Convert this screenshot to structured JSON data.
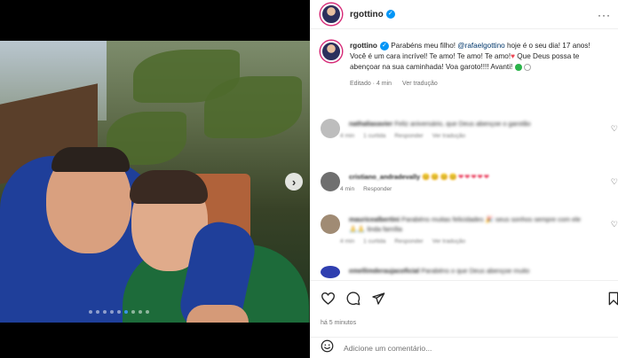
{
  "post": {
    "username": "rgottino",
    "verified_mark": "✓",
    "more_glyph": "···"
  },
  "caption": {
    "username": "rgottino",
    "text_1": " Parabéns meu filho! ",
    "mention": "@rafaelgottino",
    "text_2": " hoje é o seu dia! 17 anos! Você é um cara incrível! Te amo! Te amo! Te amo!",
    "heart": "♥",
    "text_3": " Que Deus possa te abençoar na sua caminhada! Voa garoto!!!! Avanti!",
    "edited": "Editado · 4 min",
    "translate": "Ver tradução"
  },
  "comments": [
    {
      "user": "nathaliaxavier",
      "text": "Feliz aniversário, que Deus abençoe o garotão",
      "meta_time": "4 min",
      "meta_likes": "1 curtida",
      "meta_reply": "Responder",
      "meta_translate": "Ver tradução"
    },
    {
      "user": "cristiano_andradevally",
      "text": "",
      "emoji": "😊😊😊😊",
      "emoji2": "❤❤❤❤❤",
      "meta_time": "4 min",
      "meta_reply": "Responder"
    },
    {
      "user": "mauricealbertini",
      "text": "Parabéns muitas felicidades 🎉 seus sonhos sempre com ele 🙏🙏 linda família",
      "meta_time": "4 min",
      "meta_likes": "1 curtida",
      "meta_reply": "Responder",
      "meta_translate": "Ver tradução"
    },
    {
      "user": "emellimderaujacoficial",
      "text": "Parabéns o que Deus abençoe muito"
    }
  ],
  "footer": {
    "time_ago": "há 5 minutos",
    "comment_placeholder": "Adicione um comentário..."
  },
  "carousel": {
    "total_dots": 9,
    "active_index": 5
  },
  "colors": {
    "verified": "#0095f6",
    "mention": "#00376b",
    "heart": "#ed4956",
    "active_dot": "#3b94e6"
  }
}
